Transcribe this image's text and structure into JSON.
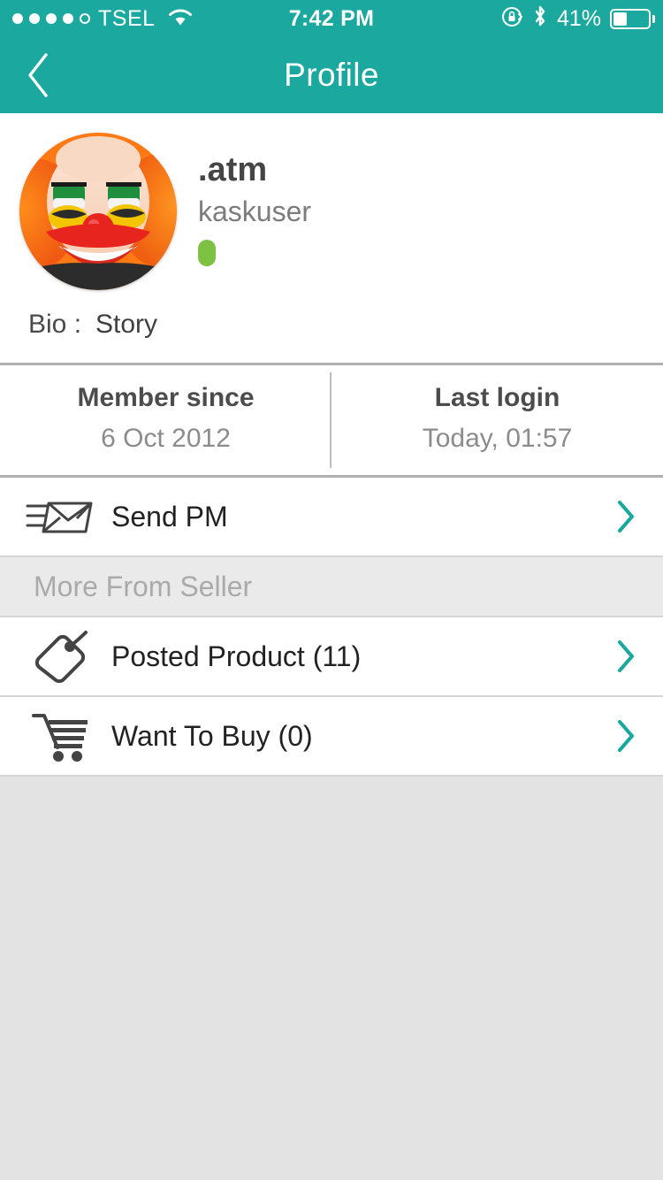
{
  "status_bar": {
    "carrier": "TSEL",
    "time": "7:42 PM",
    "battery_percent": "41%",
    "signal_dots_filled": 4,
    "signal_dots_total": 5,
    "icons": [
      "wifi-icon",
      "rotation-lock-icon",
      "bluetooth-icon",
      "battery-icon"
    ]
  },
  "nav": {
    "title": "Profile",
    "back_icon": "chevron-left-icon"
  },
  "profile": {
    "username": ".atm",
    "role": "kaskuser",
    "online": true,
    "online_color": "#7dc242",
    "avatar_alt": "clown-avatar",
    "bio_label": "Bio :",
    "bio_value": "Story"
  },
  "stats": [
    {
      "title": "Member since",
      "value": "6 Oct 2012"
    },
    {
      "title": "Last login",
      "value": "Today, 01:57"
    }
  ],
  "actions": [
    {
      "label": "Send PM",
      "icon": "send-mail-icon"
    }
  ],
  "seller_section": {
    "header": "More From Seller",
    "items": [
      {
        "label": "Posted Product (11)",
        "icon": "price-tag-icon"
      },
      {
        "label": "Want To Buy (0)",
        "icon": "shopping-cart-icon"
      }
    ]
  },
  "theme": {
    "accent": "#1aa89f",
    "chevron": "#1aa89f",
    "page_bg": "#e3e3e3",
    "card_bg": "#ffffff",
    "section_bg": "#eaeaea"
  }
}
